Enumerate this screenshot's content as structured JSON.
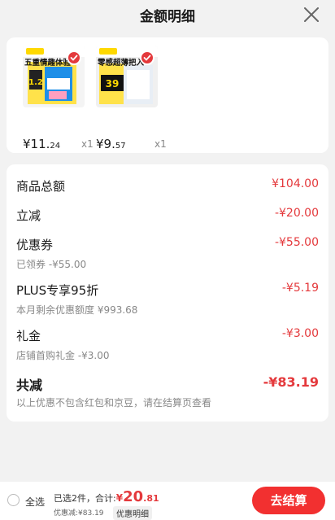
{
  "header": {
    "title": "金额明细"
  },
  "products": [
    {
      "image_text": "五重情趣体验",
      "price_int": "¥11.",
      "price_dec": "24",
      "qty": "x1"
    },
    {
      "image_text": "零感超薄把入",
      "price_int": "¥9.",
      "price_dec": "57",
      "qty": "x1"
    }
  ],
  "details": {
    "goods_total": {
      "label": "商品总额",
      "value": "¥104.00"
    },
    "instant": {
      "label": "立减",
      "value": "-¥20.00"
    },
    "coupon": {
      "label": "优惠券",
      "value": "-¥55.00",
      "sub": "已领券 -¥55.00"
    },
    "plus": {
      "label": "PLUS专享95折",
      "value": "-¥5.19",
      "sub": "本月剩余优惠额度 ¥993.68"
    },
    "gift": {
      "label": "礼金",
      "value": "-¥3.00",
      "sub": "店铺首购礼金 -¥3.00"
    },
    "total": {
      "label": "共减",
      "value": "-¥83.19",
      "sub": "以上优惠不包含红包和京豆，请在结算页查看"
    }
  },
  "bottom": {
    "select_all": "全选",
    "selected": "已选2件，合计:",
    "currency": "¥",
    "amount_int": "20",
    "amount_dec": ".81",
    "discount": "优惠减:¥83.19",
    "detail_link": "优惠明细",
    "checkout": "去结算"
  },
  "colors": {
    "accent": "#e4393c",
    "checkout_bg": "#f23030"
  }
}
